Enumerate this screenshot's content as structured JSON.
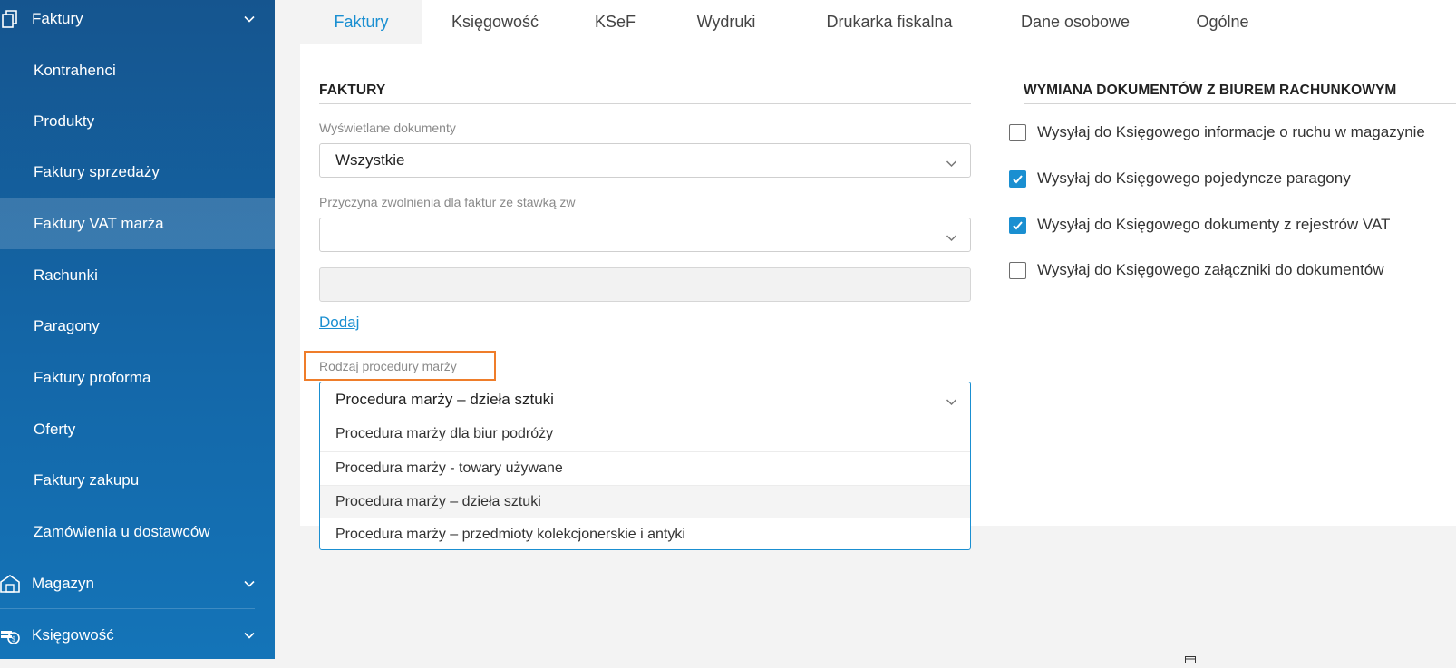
{
  "sidebar": {
    "groups": [
      {
        "label": "Faktury",
        "icon": "documents-icon",
        "expanded": true
      },
      {
        "label": "Magazyn",
        "icon": "warehouse-icon",
        "expanded": false
      },
      {
        "label": "Księgowość",
        "icon": "accounting-coins-icon",
        "expanded": false
      }
    ],
    "items": [
      {
        "label": "Kontrahenci"
      },
      {
        "label": "Produkty"
      },
      {
        "label": "Faktury sprzedaży"
      },
      {
        "label": "Faktury VAT marża",
        "active": true
      },
      {
        "label": "Rachunki"
      },
      {
        "label": "Paragony"
      },
      {
        "label": "Faktury proforma"
      },
      {
        "label": "Oferty"
      },
      {
        "label": "Faktury zakupu"
      },
      {
        "label": "Zamówienia u dostawców"
      }
    ]
  },
  "tabs": [
    {
      "label": "Faktury",
      "active": true
    },
    {
      "label": "Księgowość"
    },
    {
      "label": "KSeF"
    },
    {
      "label": "Wydruki"
    },
    {
      "label": "Drukarka fiskalna"
    },
    {
      "label": "Dane osobowe"
    },
    {
      "label": "Ogólne"
    }
  ],
  "faktury": {
    "title": "FAKTURY",
    "displayed_docs_label": "Wyświetlane dokumenty",
    "displayed_docs_value": "Wszystkie",
    "exemption_label": "Przyczyna zwolnienia dla faktur ze stawką zw",
    "exemption_value": "",
    "exemption_text_value": "",
    "add_link": "Dodaj",
    "margin_procedure_label": "Rodzaj procedury marży",
    "margin_procedure_value": "Procedura marży – dzieła sztuki",
    "margin_procedure_options": [
      "Procedura marży dla biur podróży",
      "Procedura marży - towary używane",
      "Procedura marży – dzieła sztuki",
      "Procedura marży – przedmioty kolekcjonerskie i antyki"
    ]
  },
  "exchange": {
    "title": "WYMIANA DOKUMENTÓW Z BIUREM RACHUNKOWYM",
    "options": [
      {
        "label": "Wysyłaj do Księgowego informacje o ruchu w magazynie",
        "checked": false
      },
      {
        "label": "Wysyłaj do Księgowego pojedyncze paragony",
        "checked": true
      },
      {
        "label": "Wysyłaj do Księgowego dokumenty z rejestrów VAT",
        "checked": true
      },
      {
        "label": "Wysyłaj do Księgowego załączniki do dokumentów",
        "checked": false
      }
    ]
  },
  "colors": {
    "accent": "#1a8fd1",
    "sidebar": "#1467a8",
    "highlight": "#ef7d2a"
  }
}
